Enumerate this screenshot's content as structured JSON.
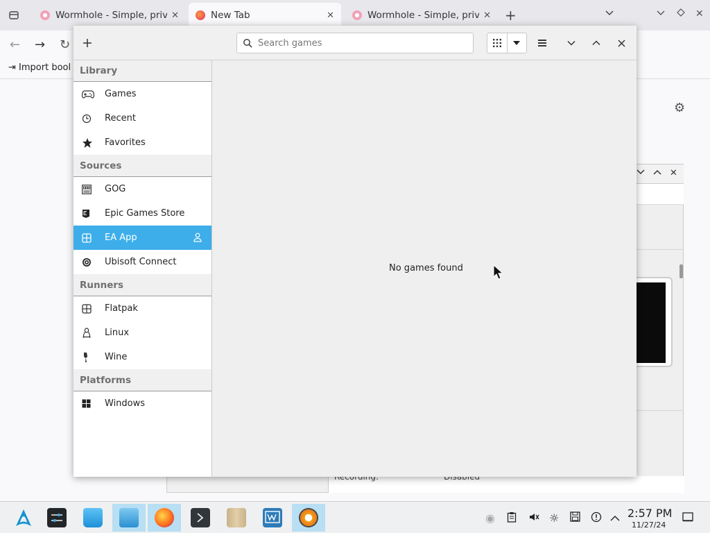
{
  "browser": {
    "tabs": [
      {
        "title": "Wormhole - Simple, privat"
      },
      {
        "title": "New Tab"
      },
      {
        "title": "Wormhole - Simple, privat"
      }
    ],
    "bookmarks_import": "Import bool"
  },
  "app": {
    "search": {
      "placeholder": "Search games"
    },
    "sidebar": {
      "library_header": "Library",
      "library_items": [
        {
          "label": "Games",
          "icon": "gamepad-icon"
        },
        {
          "label": "Recent",
          "icon": "clock-icon"
        },
        {
          "label": "Favorites",
          "icon": "star-icon"
        }
      ],
      "sources_header": "Sources",
      "source_items": [
        {
          "label": "GOG",
          "icon": "gog-icon"
        },
        {
          "label": "Epic Games Store",
          "icon": "epic-icon"
        },
        {
          "label": "EA App",
          "icon": "ea-icon",
          "selected": true
        },
        {
          "label": "Ubisoft Connect",
          "icon": "ubisoft-icon"
        }
      ],
      "runners_header": "Runners",
      "runner_items": [
        {
          "label": "Flatpak",
          "icon": "flatpak-icon"
        },
        {
          "label": "Linux",
          "icon": "linux-icon"
        },
        {
          "label": "Wine",
          "icon": "wine-icon"
        }
      ],
      "platforms_header": "Platforms",
      "platform_items": [
        {
          "label": "Windows",
          "icon": "windows-icon"
        }
      ]
    },
    "empty_message": "No games found",
    "accent_color": "#3daee9"
  },
  "background_window": {
    "label_recording": "Recording:",
    "label_disabled": "Disabled"
  },
  "taskbar": {
    "time": "2:57 PM",
    "date": "11/27/24"
  }
}
